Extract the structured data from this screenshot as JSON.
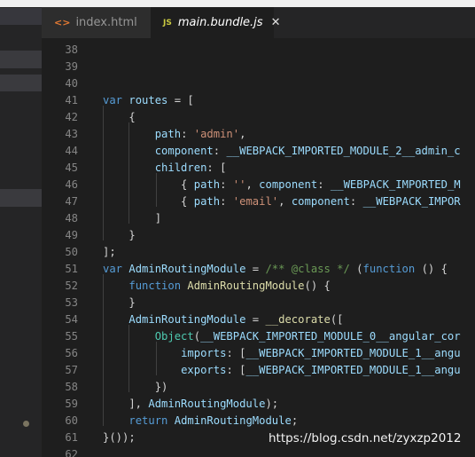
{
  "tabs": [
    {
      "icon": "<>",
      "label": "index.html"
    },
    {
      "icon": "JS",
      "label": "main.bundle.js",
      "close": "✕"
    }
  ],
  "editor": {
    "lines": [
      {
        "n": "38",
        "tokens": []
      },
      {
        "n": "39",
        "tokens": []
      },
      {
        "n": "40",
        "tokens": []
      },
      {
        "n": "41",
        "tokens": [
          [
            "kw",
            "var "
          ],
          [
            "vr",
            "routes"
          ],
          [
            "",
            ""
          ],
          [
            "p",
            " = ["
          ]
        ]
      },
      {
        "n": "42",
        "tokens": [
          [
            "p",
            "    {"
          ]
        ]
      },
      {
        "n": "43",
        "tokens": [
          [
            "p",
            "        "
          ],
          [
            "vr",
            "path"
          ],
          [
            "p",
            ": "
          ],
          [
            "str",
            "'admin'"
          ],
          [
            "p",
            ","
          ]
        ]
      },
      {
        "n": "44",
        "tokens": [
          [
            "p",
            "        "
          ],
          [
            "vr",
            "component"
          ],
          [
            "p",
            ": "
          ],
          [
            "vr",
            "__WEBPACK_IMPORTED_MODULE_2__admin_c"
          ]
        ]
      },
      {
        "n": "45",
        "tokens": [
          [
            "p",
            "        "
          ],
          [
            "vr",
            "children"
          ],
          [
            "p",
            ": ["
          ]
        ]
      },
      {
        "n": "46",
        "tokens": [
          [
            "p",
            "            { "
          ],
          [
            "vr",
            "path"
          ],
          [
            "p",
            ": "
          ],
          [
            "str",
            "''"
          ],
          [
            "p",
            ", "
          ],
          [
            "vr",
            "component"
          ],
          [
            "p",
            ": "
          ],
          [
            "vr",
            "__WEBPACK_IMPORTED_M"
          ]
        ]
      },
      {
        "n": "47",
        "tokens": [
          [
            "p",
            "            { "
          ],
          [
            "vr",
            "path"
          ],
          [
            "p",
            ": "
          ],
          [
            "str",
            "'email'"
          ],
          [
            "p",
            ", "
          ],
          [
            "vr",
            "component"
          ],
          [
            "p",
            ": "
          ],
          [
            "vr",
            "__WEBPACK_IMPOR"
          ]
        ]
      },
      {
        "n": "48",
        "tokens": [
          [
            "p",
            "        ]"
          ]
        ]
      },
      {
        "n": "49",
        "tokens": [
          [
            "p",
            "    }"
          ]
        ]
      },
      {
        "n": "50",
        "tokens": [
          [
            "p",
            "];"
          ]
        ]
      },
      {
        "n": "51",
        "tokens": [
          [
            "kw",
            "var "
          ],
          [
            "vr",
            "AdminRoutingModule"
          ],
          [
            "p",
            " = "
          ],
          [
            "cm",
            "/** @class */"
          ],
          [
            "p",
            " ("
          ],
          [
            "kw",
            "function"
          ],
          [
            "p",
            " () {"
          ]
        ]
      },
      {
        "n": "52",
        "tokens": [
          [
            "p",
            "    "
          ],
          [
            "kw",
            "function"
          ],
          [
            "p",
            " "
          ],
          [
            "fn",
            "AdminRoutingModule"
          ],
          [
            "p",
            "() {"
          ]
        ]
      },
      {
        "n": "53",
        "tokens": [
          [
            "p",
            "    }"
          ]
        ]
      },
      {
        "n": "54",
        "tokens": [
          [
            "p",
            "    "
          ],
          [
            "vr",
            "AdminRoutingModule"
          ],
          [
            "p",
            " = "
          ],
          [
            "fn",
            "__decorate"
          ],
          [
            "p",
            "(["
          ]
        ]
      },
      {
        "n": "55",
        "tokens": [
          [
            "p",
            "        "
          ],
          [
            "ty",
            "Object"
          ],
          [
            "p",
            "("
          ],
          [
            "vr",
            "__WEBPACK_IMPORTED_MODULE_0__angular_cor"
          ]
        ]
      },
      {
        "n": "56",
        "tokens": [
          [
            "p",
            "            "
          ],
          [
            "vr",
            "imports"
          ],
          [
            "p",
            ": ["
          ],
          [
            "vr",
            "__WEBPACK_IMPORTED_MODULE_1__angu"
          ]
        ]
      },
      {
        "n": "57",
        "tokens": [
          [
            "p",
            "            "
          ],
          [
            "vr",
            "exports"
          ],
          [
            "p",
            ": ["
          ],
          [
            "vr",
            "__WEBPACK_IMPORTED_MODULE_1__angu"
          ]
        ]
      },
      {
        "n": "58",
        "tokens": [
          [
            "p",
            "        })"
          ]
        ]
      },
      {
        "n": "59",
        "tokens": [
          [
            "p",
            "    ], "
          ],
          [
            "vr",
            "AdminRoutingModule"
          ],
          [
            "p",
            ");"
          ]
        ]
      },
      {
        "n": "60",
        "tokens": [
          [
            "p",
            "    "
          ],
          [
            "kw",
            "return"
          ],
          [
            "p",
            " "
          ],
          [
            "vr",
            "AdminRoutingModule"
          ],
          [
            "p",
            ";"
          ]
        ]
      },
      {
        "n": "61",
        "tokens": [
          [
            "p",
            "}());"
          ]
        ]
      },
      {
        "n": "62",
        "tokens": []
      }
    ]
  },
  "watermark": "https://blog.csdn.net/zyxzp2012",
  "colors": {
    "background": "#1e1e1e",
    "keyword": "#569cd6",
    "variable": "#9cdcfe",
    "string": "#ce9178",
    "function": "#dcdcaa",
    "type": "#4ec9b0",
    "comment": "#6a9955"
  }
}
